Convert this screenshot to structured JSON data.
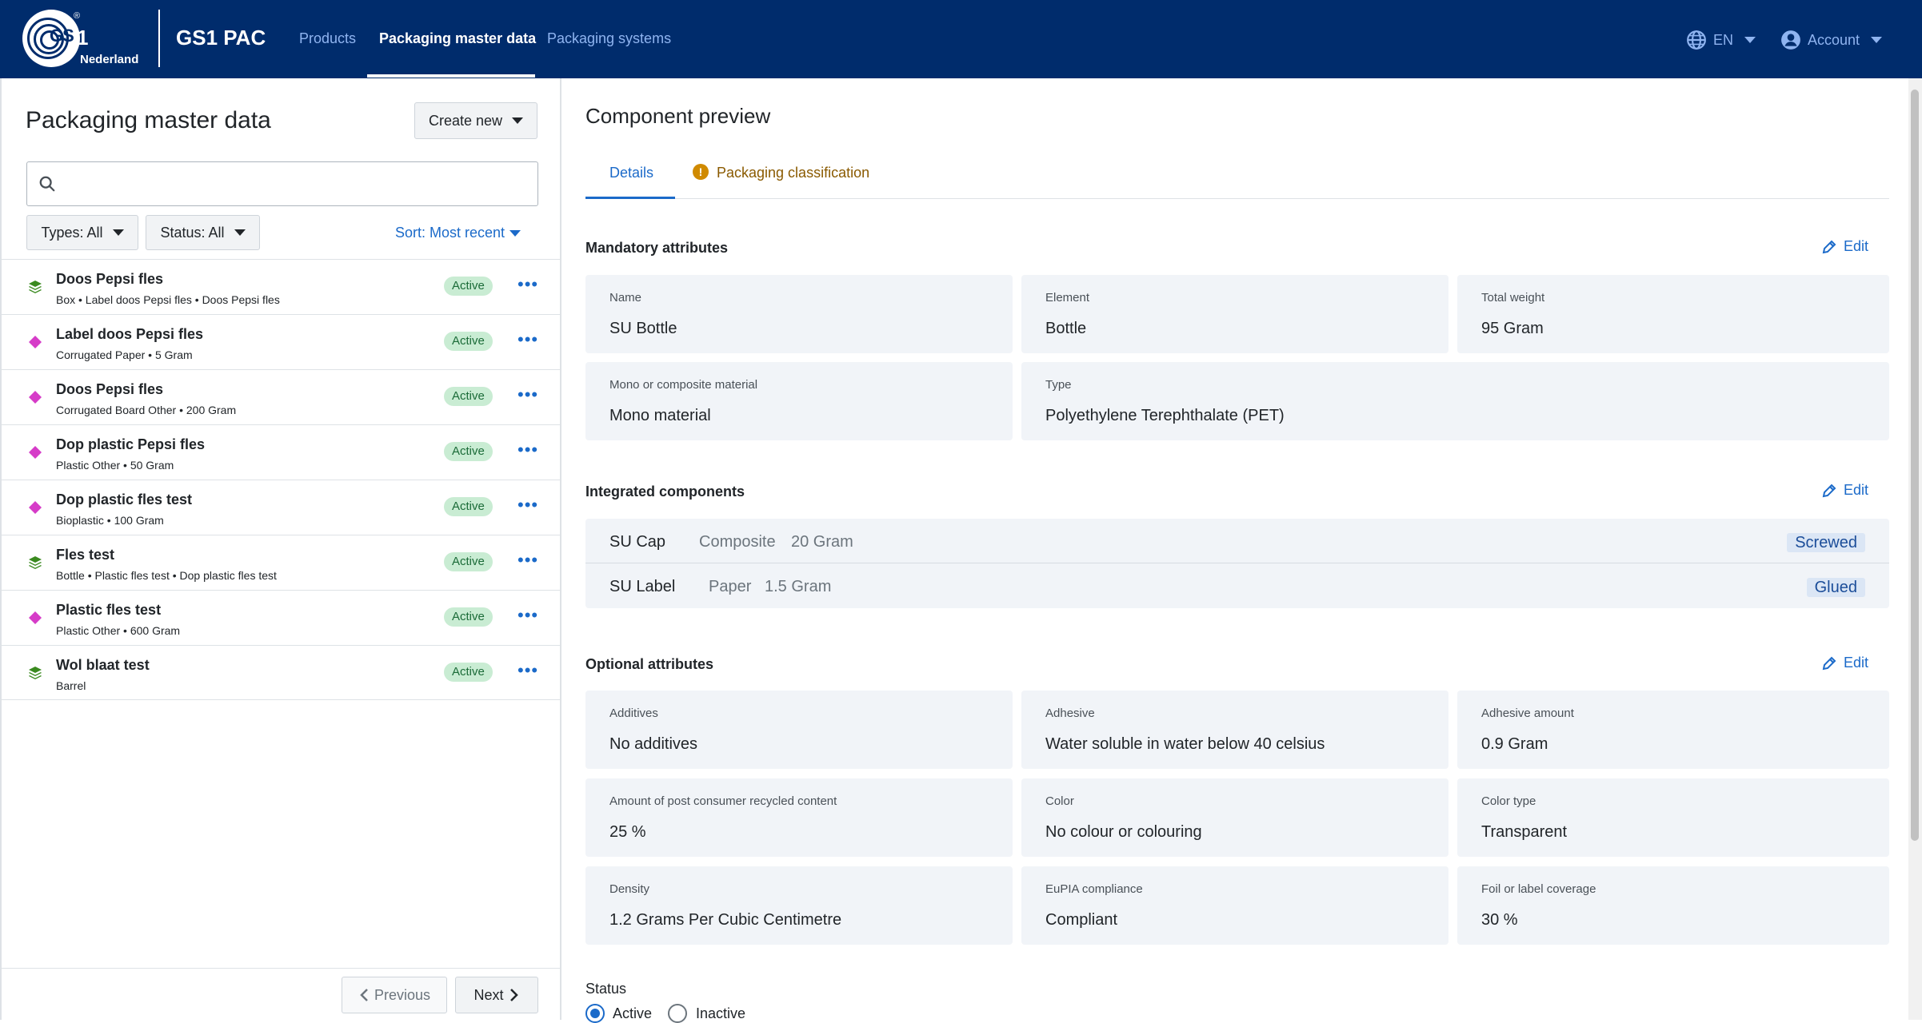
{
  "header": {
    "logo_sup": "®",
    "logo_one": "1",
    "logo_gs": "GS",
    "logo_country": "Nederland",
    "app_name": "GS1 PAC",
    "nav": [
      "Products",
      "Packaging master data",
      "Packaging systems"
    ],
    "language": "EN",
    "account": "Account"
  },
  "left": {
    "title": "Packaging master data",
    "create_new": "Create new",
    "search_placeholder": "",
    "filter_types": "Types: All",
    "filter_status": "Status: All",
    "sort": "Sort: Most recent",
    "items": [
      {
        "name": "Doos Pepsi fles",
        "sub": "Box • Label doos Pepsi fles • Doos Pepsi fles",
        "status": "Active",
        "icon": "layers-icon"
      },
      {
        "name": "Label doos Pepsi fles",
        "sub": "Corrugated Paper • 5 Gram",
        "status": "Active",
        "icon": "diamond-icon"
      },
      {
        "name": "Doos Pepsi fles",
        "sub": "Corrugated Board Other • 200 Gram",
        "status": "Active",
        "icon": "diamond-icon"
      },
      {
        "name": "Dop plastic Pepsi fles",
        "sub": "Plastic Other • 50 Gram",
        "status": "Active",
        "icon": "diamond-icon"
      },
      {
        "name": "Dop plastic fles test",
        "sub": "Bioplastic • 100 Gram",
        "status": "Active",
        "icon": "diamond-icon"
      },
      {
        "name": "Fles test",
        "sub": "Bottle • Plastic fles test • Dop plastic fles test",
        "status": "Active",
        "icon": "layers-icon"
      },
      {
        "name": "Plastic fles test",
        "sub": "Plastic Other • 600 Gram",
        "status": "Active",
        "icon": "diamond-icon"
      },
      {
        "name": "Wol blaat test",
        "sub": "Barrel",
        "status": "Active",
        "icon": "layers-icon"
      }
    ],
    "previous": "Previous",
    "next": "Next"
  },
  "preview": {
    "title": "Component preview",
    "tab_details": "Details",
    "tab_classification": "Packaging classification",
    "warn_glyph": "!",
    "edit": "Edit",
    "mandatory_title": "Mandatory attributes",
    "mandatory": [
      {
        "label": "Name",
        "value": "SU Bottle"
      },
      {
        "label": "Element",
        "value": "Bottle"
      },
      {
        "label": "Total weight",
        "value": "95 Gram"
      },
      {
        "label": "Mono or composite material",
        "value": "Mono material"
      },
      {
        "label": "Type",
        "value": "Polyethylene Terephthalate (PET)"
      }
    ],
    "integrated_title": "Integrated components",
    "components": [
      {
        "name": "SU Cap",
        "material": "Composite",
        "weight": "20 Gram",
        "tag": "Screwed"
      },
      {
        "name": "SU Label",
        "material": "Paper",
        "weight": "1.5 Gram",
        "tag": "Glued"
      }
    ],
    "optional_title": "Optional attributes",
    "optional": [
      {
        "label": "Additives",
        "value": "No additives"
      },
      {
        "label": "Adhesive",
        "value": "Water soluble in water below 40 celsius"
      },
      {
        "label": "Adhesive amount",
        "value": "0.9 Gram"
      },
      {
        "label": "Amount of post consumer recycled content",
        "value": "25 %"
      },
      {
        "label": "Color",
        "value": "No colour or colouring"
      },
      {
        "label": "Color type",
        "value": "Transparent"
      },
      {
        "label": "Density",
        "value": "1.2 Grams Per Cubic Centimetre"
      },
      {
        "label": "EuPIA compliance",
        "value": "Compliant"
      },
      {
        "label": "Foil or label coverage",
        "value": "30 %"
      }
    ],
    "status_label": "Status",
    "status_active": "Active",
    "status_inactive": "Inactive",
    "status_selected": "Active"
  },
  "colors": {
    "header_bg": "#002c6c",
    "accent": "#1b6ac9",
    "badge_green": "#c9ecd3",
    "diamond_magenta": "#d63cc8",
    "layers_green": "#3a8a1f"
  }
}
